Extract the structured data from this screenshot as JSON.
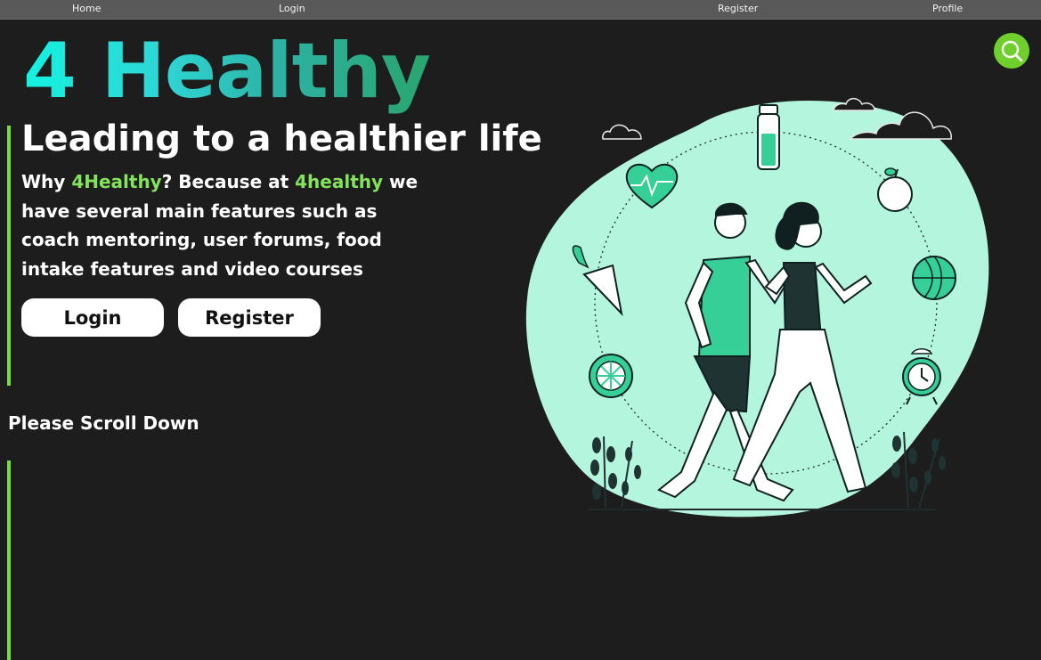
{
  "nav": {
    "home": "Home",
    "login": "Login",
    "register": "Register",
    "profile": "Profile"
  },
  "logo": {
    "text": "4 Healthy"
  },
  "search": {
    "icon": "search-icon"
  },
  "hero": {
    "headline": "Leading to a healthier life",
    "desc_part1": "Why ",
    "desc_brand1": "4Healthy",
    "desc_part2": "? Because at ",
    "desc_brand2": "4healthy",
    "desc_part3": " we have several main features such as coach mentoring, user forums, food intake features and video courses",
    "login_button": "Login",
    "register_button": "Register"
  },
  "scroll_hint": "Please Scroll Down",
  "colors": {
    "background": "#1d1d1d",
    "nav_bar": "#595959",
    "accent_green": "#84e35c",
    "search_button": "#6fcf2c",
    "illustration_blob": "#b4f5dd"
  },
  "illustration": {
    "icon": "couple-walking-illustration"
  }
}
